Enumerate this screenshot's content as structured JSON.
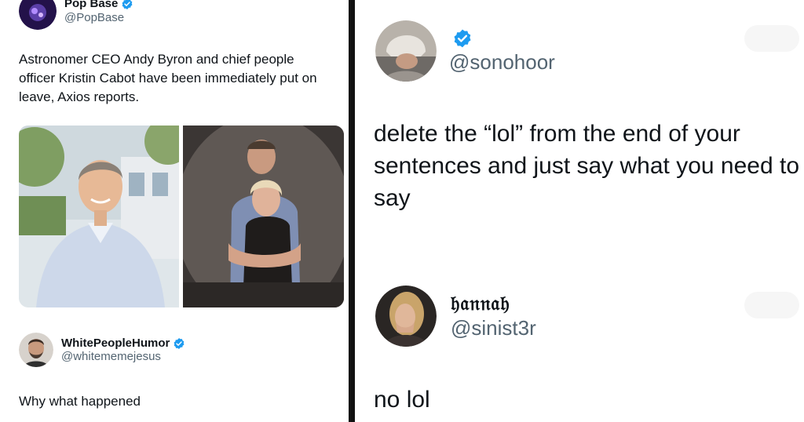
{
  "left_panel": {
    "top_tweet": {
      "display_name": "Pop Base",
      "handle": "@PopBase",
      "verified": true,
      "text": "Astronomer CEO Andy Byron and chief people officer Kristin Cabot have been immediately put on leave, Axios reports."
    },
    "reply_tweet": {
      "display_name": "WhitePeopleHumor",
      "handle": "@whitememejesus",
      "verified": true,
      "text": "Why what happened"
    }
  },
  "right_panel": {
    "top_tweet": {
      "display_name": "",
      "handle": "@sonohoor",
      "verified": true,
      "text": "delete the “lol” from the end of your sentences and just say what you need to say"
    },
    "reply_tweet": {
      "display_name": "𝔥𝔞𝔫𝔫𝔞𝔥",
      "handle": "@sinist3r",
      "verified": false,
      "text": "no lol"
    }
  },
  "colors": {
    "verified_blue": "#1d9bf0",
    "text_primary": "#0f1419",
    "text_secondary": "#536471",
    "divider": "#111111"
  },
  "icons": {
    "verified": "verified-badge-icon"
  }
}
